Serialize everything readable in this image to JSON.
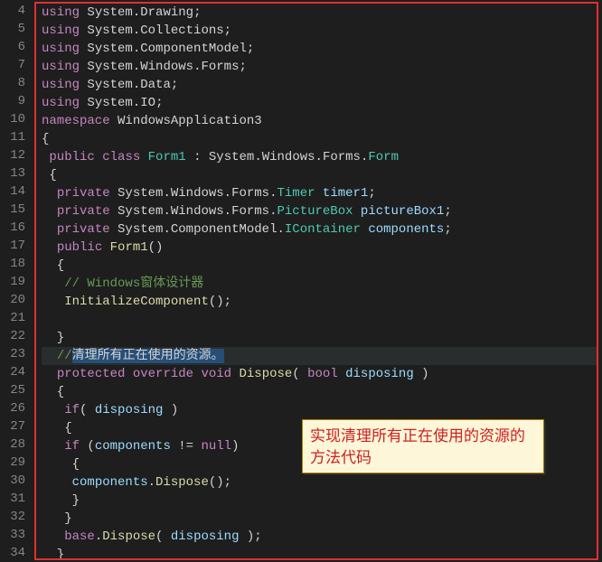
{
  "gutter_start": 4,
  "gutter_end": 34,
  "callout_text": "实现清理所有正在使用的资源的方法代码",
  "code": {
    "l4": {
      "pre": "",
      "raw": "using System.Drawing;"
    },
    "l5": {
      "pre": "",
      "raw": "using System.Collections;"
    },
    "l6": {
      "pre": "",
      "raw": "using System.ComponentModel;"
    },
    "l7": {
      "pre": "",
      "raw": "using System.Windows.Forms;"
    },
    "l8": {
      "pre": "",
      "raw": "using System.Data;"
    },
    "l9": {
      "pre": "",
      "raw": "using System.IO;"
    },
    "l10": {
      "pre": "",
      "raw": "namespace WindowsApplication3"
    },
    "l11": {
      "pre": "",
      "raw": "{"
    },
    "l12": {
      "pre": " ",
      "raw": "public class Form1 : System.Windows.Forms.Form"
    },
    "l13": {
      "pre": " ",
      "raw": "{"
    },
    "l14": {
      "pre": "  ",
      "raw": "private System.Windows.Forms.Timer timer1;"
    },
    "l15": {
      "pre": "  ",
      "raw": "private System.Windows.Forms.PictureBox pictureBox1;"
    },
    "l16": {
      "pre": "  ",
      "raw": "private System.ComponentModel.IContainer components;"
    },
    "l17": {
      "pre": "  ",
      "raw": "public Form1()"
    },
    "l18": {
      "pre": "  ",
      "raw": "{"
    },
    "l19": {
      "pre": "   ",
      "raw": "// Windows窗体设计器"
    },
    "l20": {
      "pre": "   ",
      "raw": "InitializeComponent();"
    },
    "l21": {
      "pre": "",
      "raw": ""
    },
    "l22": {
      "pre": "  ",
      "raw": "}"
    },
    "l23": {
      "pre": "  ",
      "comment_prefix": "//",
      "selected": "清理所有正在使用的资源。"
    },
    "l24": {
      "pre": "  ",
      "raw": "protected override void Dispose( bool disposing )"
    },
    "l25": {
      "pre": "  ",
      "raw": "{"
    },
    "l26": {
      "pre": "   ",
      "raw": "if( disposing )"
    },
    "l27": {
      "pre": "   ",
      "raw": "{"
    },
    "l28": {
      "pre": "   ",
      "raw": "if (components != null)"
    },
    "l29": {
      "pre": "    ",
      "raw": "{"
    },
    "l30": {
      "pre": "    ",
      "raw": "components.Dispose();"
    },
    "l31": {
      "pre": "    ",
      "raw": "}"
    },
    "l32": {
      "pre": "   ",
      "raw": "}"
    },
    "l33": {
      "pre": "   ",
      "raw": "base.Dispose( disposing );"
    },
    "l34": {
      "pre": "  ",
      "raw": "}"
    }
  },
  "tokens": {
    "using": "using",
    "namespace": "namespace",
    "public": "public",
    "class": "class",
    "private": "private",
    "protected": "protected",
    "override": "override",
    "void": "void",
    "bool": "bool",
    "if": "if",
    "null": "null",
    "base": "base",
    "System": "System",
    "Drawing": "Drawing",
    "Collections": "Collections",
    "ComponentModel": "ComponentModel",
    "Windows": "Windows",
    "Forms": "Forms",
    "Data": "Data",
    "IO": "IO",
    "WindowsApplication3": "WindowsApplication3",
    "Form1": "Form1",
    "Form": "Form",
    "Timer": "Timer",
    "PictureBox": "PictureBox",
    "IContainer": "IContainer",
    "timer1": "timer1",
    "pictureBox1": "pictureBox1",
    "components": "components",
    "InitializeComponent": "InitializeComponent",
    "Dispose": "Dispose",
    "disposing": "disposing",
    "comment19": "// Windows窗体设计器"
  }
}
